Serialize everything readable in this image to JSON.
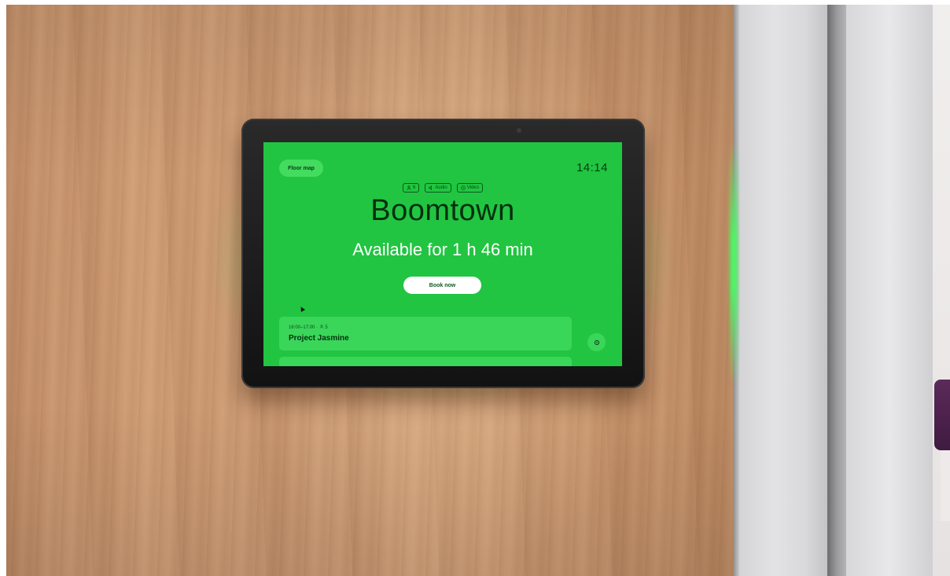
{
  "screen": {
    "floor_map_label": "Floor map",
    "clock": "14:14",
    "amenities": [
      {
        "icon": "person-icon",
        "label": "6"
      },
      {
        "icon": "audio-icon",
        "label": "Audio"
      },
      {
        "icon": "video-icon",
        "label": "Video"
      }
    ],
    "room_name": "Boomtown",
    "status_text": "Available for 1 h 46 min",
    "book_label": "Book now",
    "bookings": [
      {
        "time": "16:00–17:00",
        "attendees": "5",
        "title": "Project Jasmine"
      }
    ]
  },
  "colors": {
    "screen_bg": "#21c541",
    "card_bg": "#3ad65a",
    "glow": "#3cf05a"
  }
}
